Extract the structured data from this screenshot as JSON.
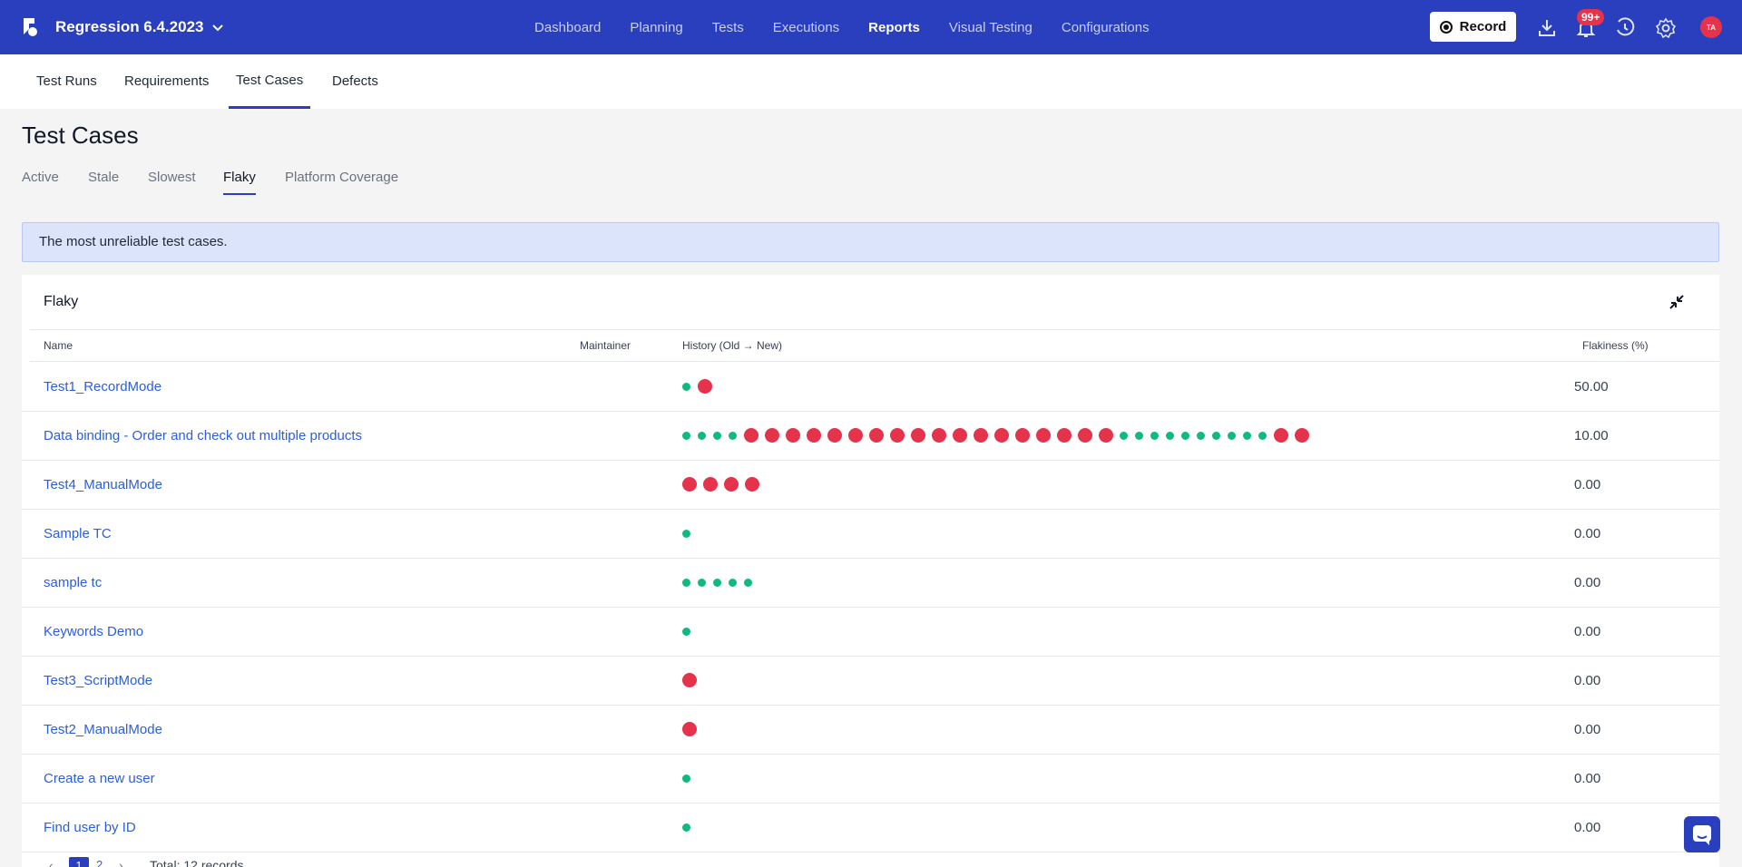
{
  "topbar": {
    "project_name": "Regression 6.4.2023",
    "nav": [
      "Dashboard",
      "Planning",
      "Tests",
      "Executions",
      "Reports",
      "Visual Testing",
      "Configurations"
    ],
    "active_nav": "Reports",
    "record_label": "Record",
    "notification_badge": "99+",
    "avatar_initials": "TA",
    "accent_color": "#2a3fbd"
  },
  "subnav": {
    "tabs": [
      "Test Runs",
      "Requirements",
      "Test Cases",
      "Defects"
    ],
    "active": "Test Cases"
  },
  "page": {
    "title": "Test Cases",
    "tabs": [
      "Active",
      "Stale",
      "Slowest",
      "Flaky",
      "Platform Coverage"
    ],
    "active_tab": "Flaky",
    "info_text": "The most unreliable test cases."
  },
  "card": {
    "title": "Flaky",
    "columns": {
      "name": "Name",
      "maintainer": "Maintainer",
      "history": "History (Old → New)",
      "flakiness": "Flakiness (%)"
    },
    "rows": [
      {
        "name": "Test1_RecordMode",
        "maintainer": "",
        "history": "PF",
        "flakiness": "50.00"
      },
      {
        "name": "Data binding - Order and check out multiple products",
        "maintainer": "",
        "history": "PPPPFFFFFFFFFFFFFFFFFFPPPPPPPPPPFF",
        "flakiness": "10.00"
      },
      {
        "name": "Test4_ManualMode",
        "maintainer": "",
        "history": "FFFF",
        "flakiness": "0.00"
      },
      {
        "name": "Sample TC",
        "maintainer": "",
        "history": "P",
        "flakiness": "0.00"
      },
      {
        "name": "sample tc",
        "maintainer": "",
        "history": "PPPPP",
        "flakiness": "0.00"
      },
      {
        "name": "Keywords Demo",
        "maintainer": "",
        "history": "P",
        "flakiness": "0.00"
      },
      {
        "name": "Test3_ScriptMode",
        "maintainer": "",
        "history": "F",
        "flakiness": "0.00"
      },
      {
        "name": "Test2_ManualMode",
        "maintainer": "",
        "history": "F",
        "flakiness": "0.00"
      },
      {
        "name": "Create a new user",
        "maintainer": "",
        "history": "P",
        "flakiness": "0.00"
      },
      {
        "name": "Find user by ID",
        "maintainer": "",
        "history": "P",
        "flakiness": "0.00"
      }
    ],
    "pass_color": "#10b981",
    "fail_color": "#e5334b"
  },
  "pagination": {
    "pages": [
      "1",
      "2"
    ],
    "current": "1",
    "total_text": "Total: 12 records"
  }
}
